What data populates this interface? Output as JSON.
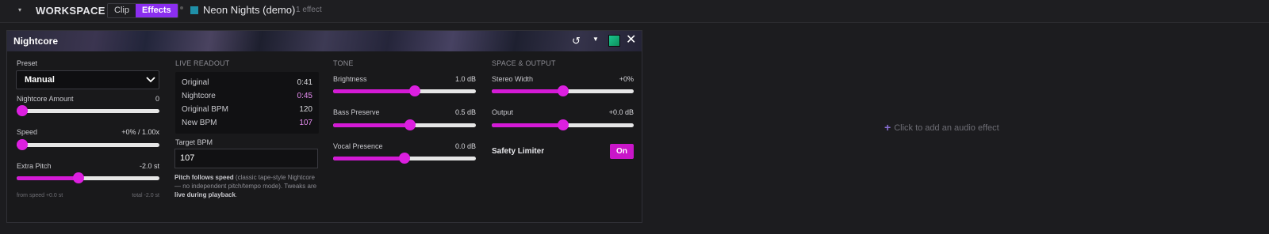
{
  "topbar": {
    "title": "WORKSPACE",
    "tabs": [
      {
        "label": "Clip",
        "active": false
      },
      {
        "label": "Effects",
        "active": true
      }
    ],
    "track_name": "Neon Nights (demo)",
    "track_color": "#1f8fa8",
    "effect_count": "1 effect"
  },
  "panel": {
    "title": "Nightcore",
    "header_icons": [
      "reset-icon",
      "chevron-down-icon",
      "color-swatch",
      "close-icon"
    ],
    "preset": {
      "label": "Preset",
      "value": "Manual"
    },
    "nightcore_amount": {
      "label": "Nightcore Amount",
      "value": "0",
      "level": 0.0
    },
    "speed": {
      "label": "Speed",
      "value": "+0% / 1.00x",
      "level": 0.0
    },
    "extra_pitch": {
      "label": "Extra Pitch",
      "value": "-2.0 st",
      "level": 0.43
    },
    "pitch_footer": {
      "from_speed": "from speed +0.0 st",
      "total": "total -2.0 st"
    },
    "readout": {
      "heading": "LIVE READOUT",
      "rows": [
        {
          "key": "Original",
          "value": "0:41",
          "highlight": false
        },
        {
          "key": "Nightcore",
          "value": "0:45",
          "highlight": true
        },
        {
          "key": "Original BPM",
          "value": "120",
          "highlight": false
        },
        {
          "key": "New BPM",
          "value": "107",
          "highlight": true
        }
      ]
    },
    "target_bpm": {
      "label": "Target BPM",
      "value": "107"
    },
    "note": {
      "bold1": "Pitch follows speed",
      "text1": " (classic tape-style Nightcore — no independent pitch/tempo mode). Tweaks are ",
      "bold2": "live during playback",
      "text2": "."
    },
    "tone": {
      "heading": "TONE",
      "brightness": {
        "label": "Brightness",
        "value": "1.0 dB",
        "level": 0.58
      },
      "bass_preserve": {
        "label": "Bass Preserve",
        "value": "0.5 dB",
        "level": 0.54
      },
      "vocal_presence": {
        "label": "Vocal Presence",
        "value": "0.0 dB",
        "level": 0.5
      }
    },
    "space": {
      "heading": "SPACE & OUTPUT",
      "stereo_width": {
        "label": "Stereo Width",
        "value": "+0%",
        "level": 0.5
      },
      "output": {
        "label": "Output",
        "value": "+0.0 dB",
        "level": 0.5
      },
      "safety": {
        "label": "Safety Limiter",
        "toggle": "On"
      }
    }
  },
  "empty_slot": {
    "label": "Click to add an audio effect"
  },
  "colors": {
    "accent": "#8b2ef0",
    "slider": "#dc1fe0",
    "readout_highlight": "#e58cf0"
  }
}
